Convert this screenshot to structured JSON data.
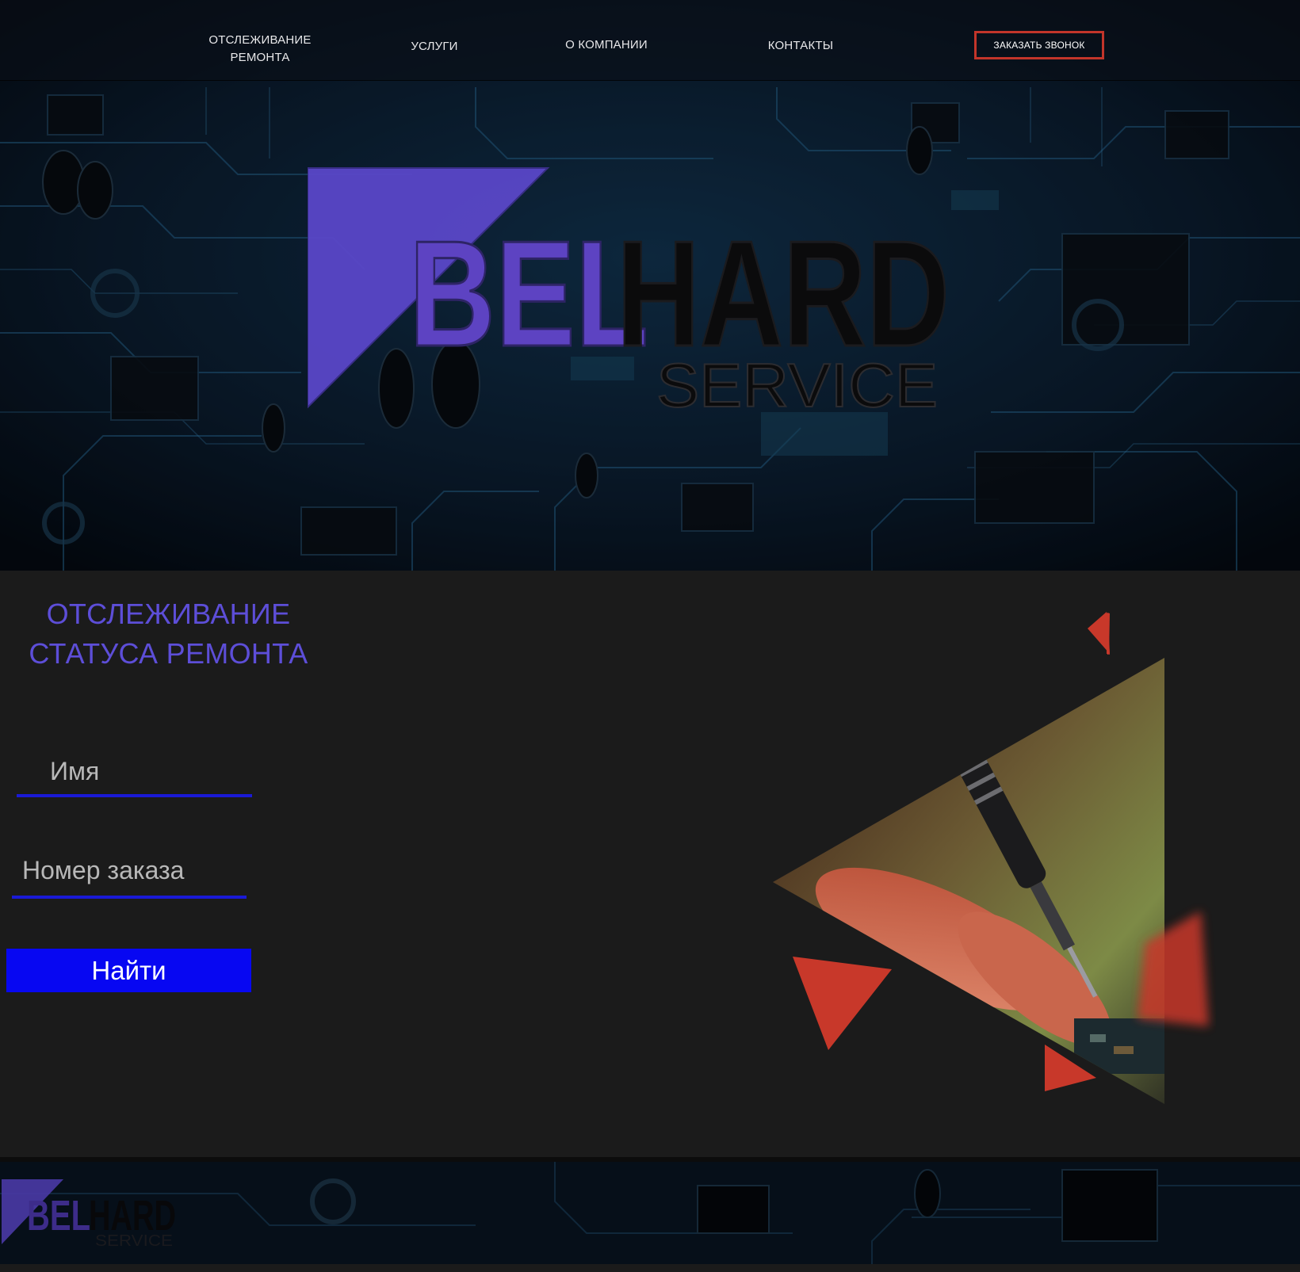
{
  "nav": {
    "tracking_label": "ОТСЛЕЖИВАНИЕ\nРЕМОНТА",
    "services_label": "УСЛУГИ",
    "about_label": "О КОМПАНИИ",
    "contacts_label": "КОНТАКТЫ",
    "call_button_label": "ЗАКАЗАТЬ ЗВОНОК"
  },
  "logo": {
    "part1": "BEL",
    "part2": "HARD",
    "part3": "SERVICE"
  },
  "tracking": {
    "title": "ОТСЛЕЖИВАНИЕ СТАТУСА РЕМОНТА",
    "name_placeholder": "Имя",
    "order_placeholder": "Номер заказа",
    "find_button_label": "Найти"
  },
  "colors": {
    "accent_purple": "#5d4ed8",
    "button_blue": "#0707f2",
    "call_border_red": "#c2352a",
    "triangle_red": "#cf3a24",
    "page_bg": "#1b1b1b"
  }
}
